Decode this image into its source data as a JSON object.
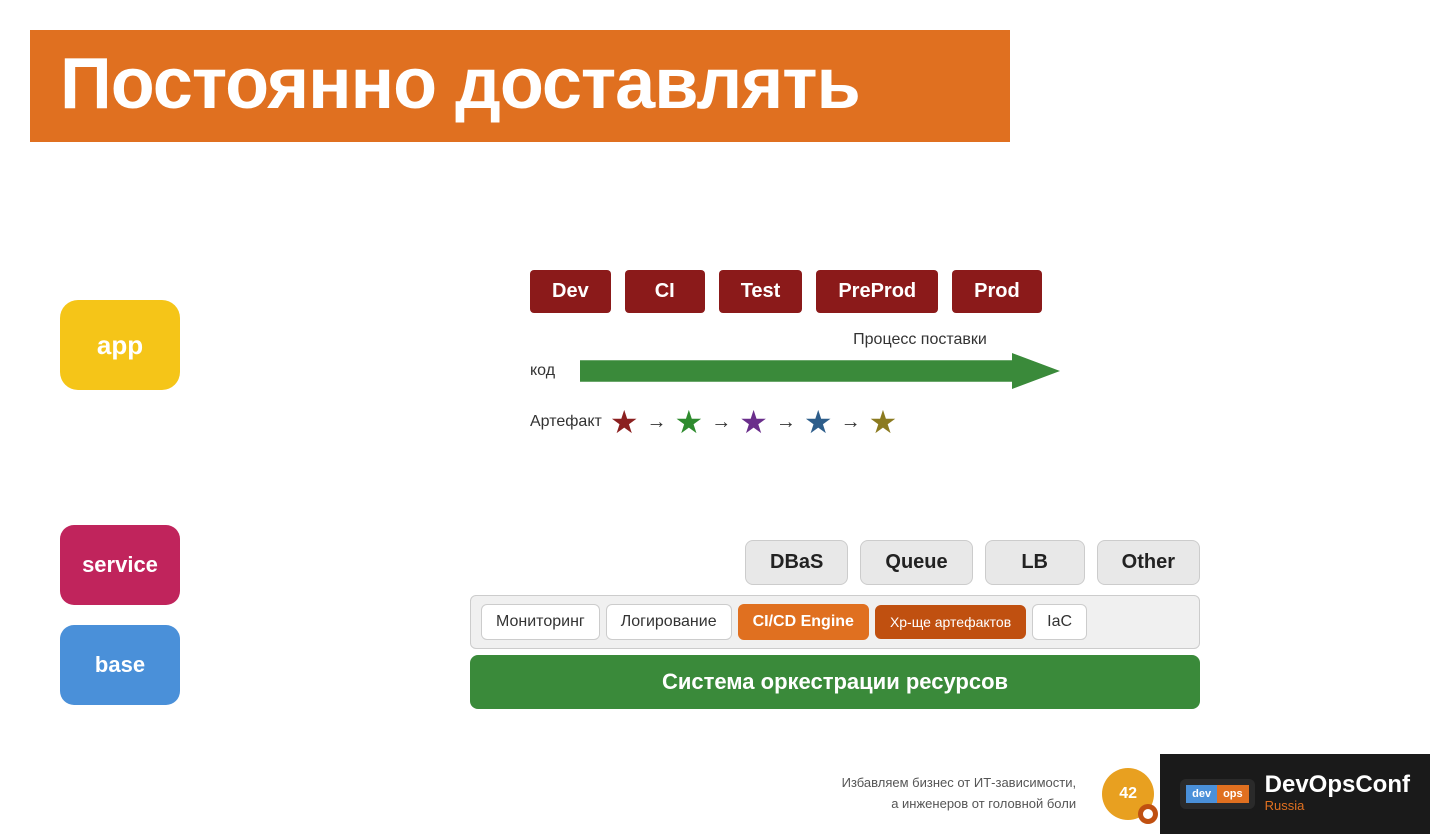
{
  "header": {
    "title": "Постоянно доставлять"
  },
  "left_boxes": {
    "app": "app",
    "service": "service",
    "base": "base"
  },
  "pipeline": {
    "stages": [
      "Dev",
      "CI",
      "Test",
      "PreProd",
      "Prod"
    ],
    "delivery_label": "Процесс поставки",
    "kod_label": "код",
    "artifact_label": "Артефакт"
  },
  "stars": [
    {
      "color": "#8B2020",
      "unicode": "★"
    },
    {
      "color": "#2E8B2E",
      "unicode": "★"
    },
    {
      "color": "#6A2E8B",
      "unicode": "★"
    },
    {
      "color": "#2E5E8B",
      "unicode": "★"
    },
    {
      "color": "#8B7A20",
      "unicode": "★"
    }
  ],
  "service_boxes": [
    "DBaS",
    "Queue",
    "LB",
    "Other"
  ],
  "tools": [
    {
      "label": "Мониторинг",
      "style": "normal"
    },
    {
      "label": "Логирование",
      "style": "normal"
    },
    {
      "label": "CI/CD Engine",
      "style": "orange"
    },
    {
      "label": "Хр-ще артефактов",
      "style": "orange2"
    },
    {
      "label": "IaC",
      "style": "normal"
    }
  ],
  "orchestration": {
    "label": "Система оркестрации ресурсов"
  },
  "footer": {
    "line1": "Избавляем бизнес от ИТ-зависимости,",
    "line2": "а инженеров от головной боли",
    "badge": "42",
    "devops_top": "DevOps",
    "devops_conf": "Conf",
    "devops_russia": "Russia"
  }
}
